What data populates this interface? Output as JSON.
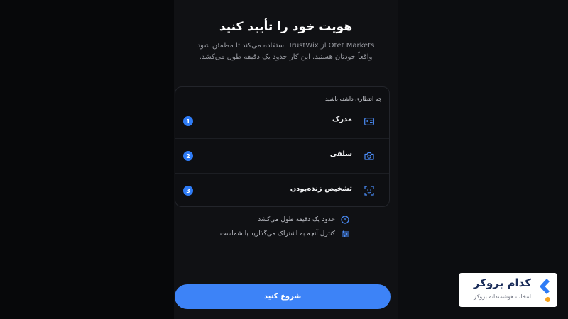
{
  "page": {
    "title": "هویت خود را تأیید کنید",
    "subtitle": "Otet Markets از TrustWix استفاده می‌کند تا مطمئن شود واقعاً خودتان هستید. این کار حدود یک دقیقه طول می‌کشد."
  },
  "expectations": {
    "heading": "چه انتظاری داشته باشید",
    "steps": [
      {
        "number": "1",
        "label": "مدرک",
        "icon": "id-card-icon"
      },
      {
        "number": "2",
        "label": "سلفی",
        "icon": "camera-icon"
      },
      {
        "number": "3",
        "label": "تشخیص زنده‌بودن",
        "icon": "face-scan-icon"
      }
    ]
  },
  "info": {
    "duration": "حدود یک دقیقه طول می‌کشد",
    "control": "کنترل آنچه به اشتراک می‌گذارید با شماست"
  },
  "actions": {
    "start_label": "شروع کنید"
  },
  "brand": {
    "name": "کدام بروکر",
    "tagline": "انتخاب هوشمندانه بروکر"
  },
  "colors": {
    "accent": "#3d83f7",
    "background": "#07080a",
    "panel": "#101114",
    "brand_orange": "#f7a21b",
    "brand_blue": "#2f7cf6"
  }
}
